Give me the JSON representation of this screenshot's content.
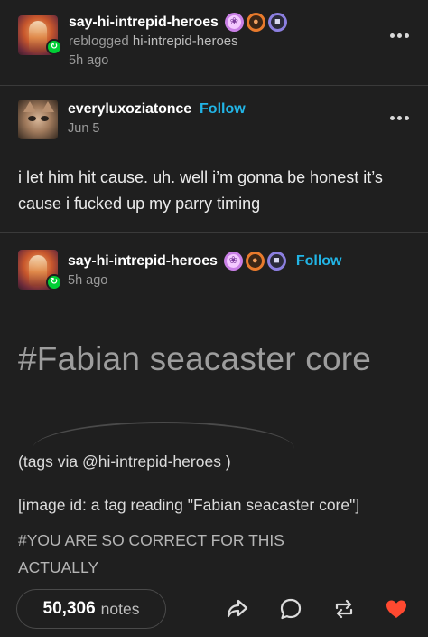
{
  "post_header": {
    "username": "say-hi-intrepid-heroes",
    "reblogged_label": "reblogged",
    "reblogged_from": "hi-intrepid-heroes",
    "time": "5h ago",
    "avatar_icon": "red-character-avatar",
    "badges": [
      "purple-paw-badge",
      "orange-paw-badge",
      "cat-face-badge"
    ]
  },
  "reblog_1": {
    "username": "everyluxoziatonce",
    "follow_label": "Follow",
    "date": "Jun 5",
    "avatar_icon": "cat-avatar",
    "text": "i let him hit cause. uh. well i’m gonna be honest it’s cause i fucked up my parry timing"
  },
  "reblog_2": {
    "username": "say-hi-intrepid-heroes",
    "follow_label": "Follow",
    "time": "5h ago",
    "avatar_icon": "red-character-avatar",
    "tag_image_text": "#Fabian seacaster core",
    "tags_via_prefix": "(tags via ",
    "tags_via_mention": "@hi-intrepid-heroes",
    "tags_via_suffix": " )",
    "image_id": "[image id: a tag reading \"Fabian seacaster core\"]",
    "tags_line_1": "#YOU ARE SO CORRECT FOR THIS",
    "tags_line_2": "ACTUALLY"
  },
  "footer": {
    "notes_count": "50,306",
    "notes_label": "notes",
    "actions": [
      "share-icon",
      "reply-icon",
      "reblog-icon",
      "like-heart-icon"
    ]
  },
  "colors": {
    "background": "#1f1f1f",
    "accent_follow": "#22b5e6",
    "reblog_green": "#00cf35",
    "like_red": "#ff4930"
  }
}
